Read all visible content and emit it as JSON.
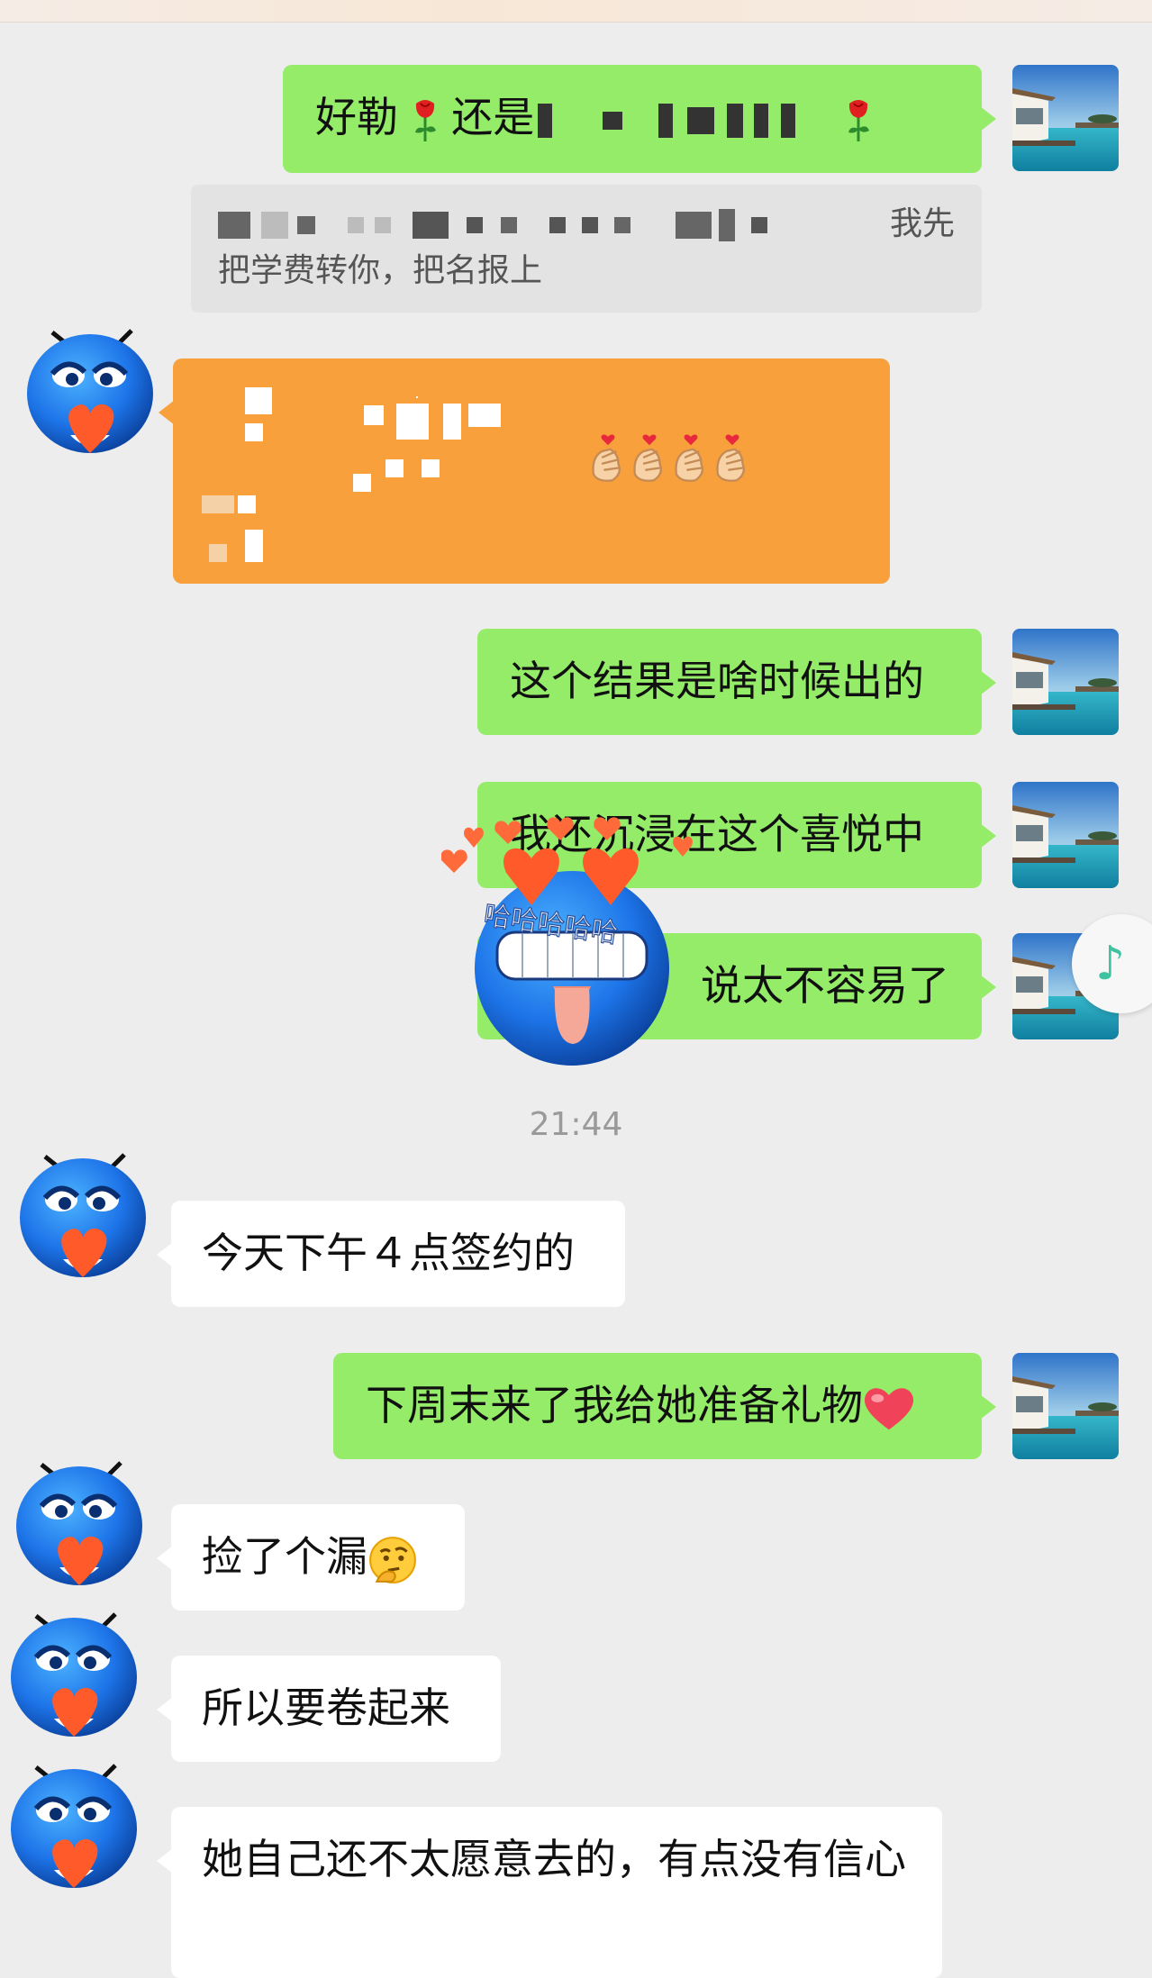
{
  "messages": {
    "m1": {
      "prefix": "好勒",
      "mid": "还是"
    },
    "quote": {
      "end": "我先",
      "line2": "把学费转你，把名报上"
    },
    "m3": "这个结果是啥时候出的",
    "m4": "我还沉浸在这个喜悦中",
    "m5": "说太不容易了",
    "time": "21:44",
    "m6": "今天下午４点签约的",
    "m7": "下周末来了我给她准备礼物",
    "m8": "捡了个漏",
    "m9": "所以要卷起来",
    "m10": "她自己还不太愿意去的，有点没有信心"
  },
  "sticker_text": "哈哈哈哈哈",
  "colors": {
    "green_bubble": "#95ec69",
    "white_bubble": "#ffffff",
    "orange_bubble": "#f8a03b",
    "background": "#ededed"
  },
  "icons": [
    "rose-icon",
    "finger-heart-icon",
    "music-note-icon",
    "red-heart-icon",
    "thinking-face-icon"
  ]
}
